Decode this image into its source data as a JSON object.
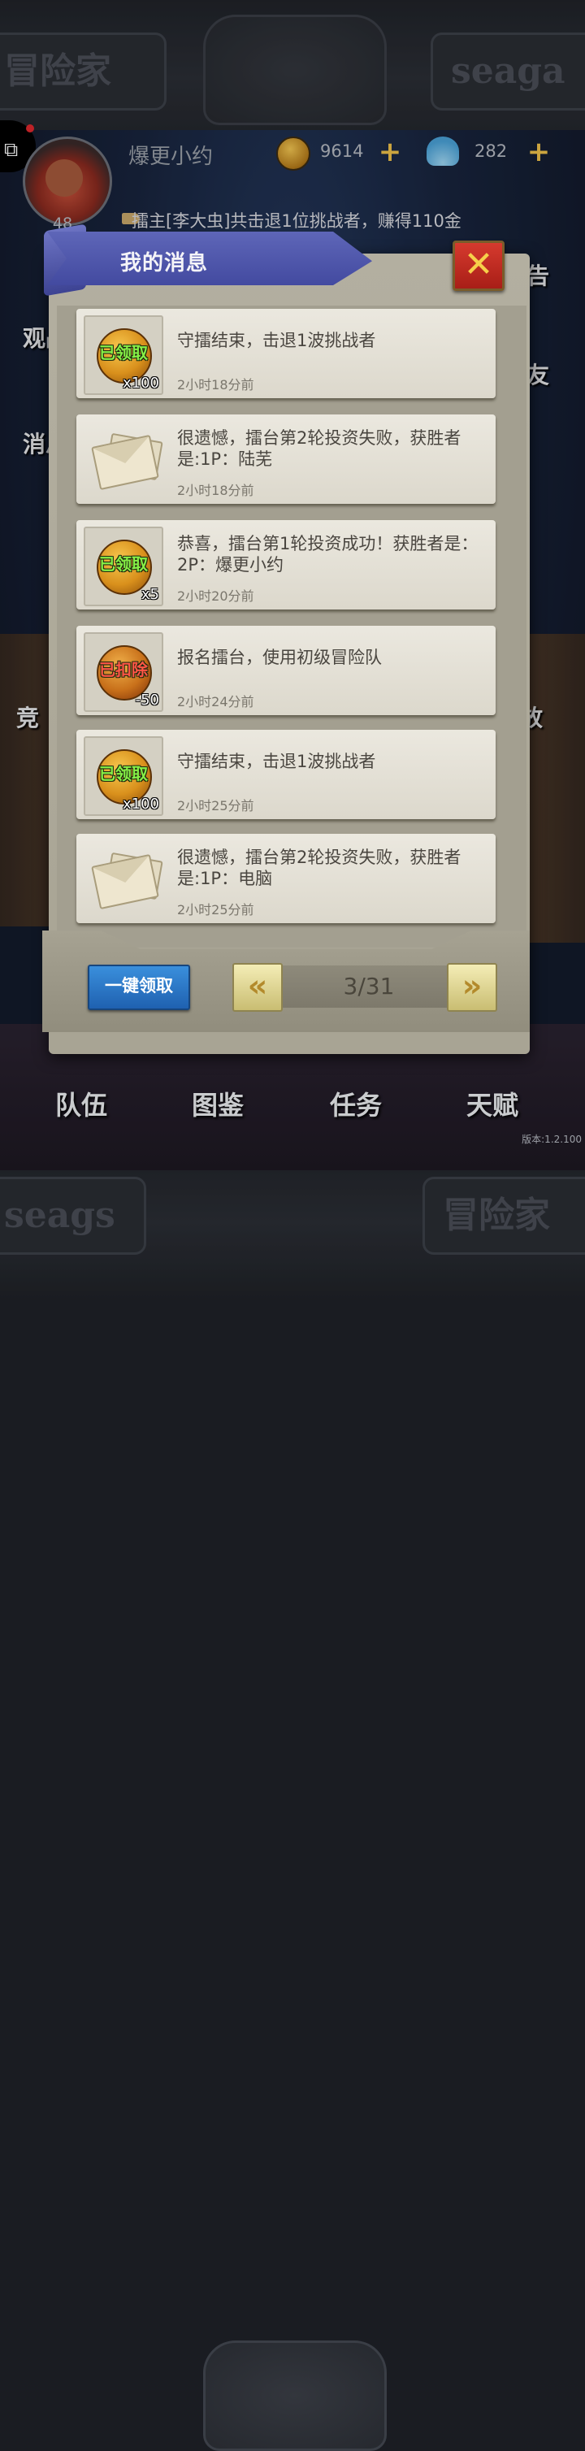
{
  "background": {
    "banner_left": "冒险家",
    "banner_right": "seaga",
    "banner_bottom_left": "seags",
    "banner_bottom_right": "冒险家"
  },
  "hud": {
    "level": "48",
    "player_name": "爆更小约",
    "coins": "9614",
    "shells": "282",
    "ticker": "擂主[李大虫]共击退1位挑战者，赚得110金"
  },
  "side_labels": {
    "guanzhan": "观战",
    "xiaoxi": "消息",
    "gonggao": "公告",
    "haoyou": "好友",
    "jing": "竞",
    "fang": "放"
  },
  "bottom_nav": [
    "队伍",
    "图鉴",
    "任务",
    "天赋"
  ],
  "version": "版本:1.2.100",
  "modal": {
    "title": "我的消息",
    "close": "✕",
    "messages": [
      {
        "icon": "coin-icon",
        "stamp": "已领取",
        "stamp_color": "#86ef46",
        "qty": "x100",
        "text": "守擂结束，击退1波挑战者",
        "time": "2小时18分前"
      },
      {
        "icon": "envelope-icon",
        "text": "很遗憾，擂台第2轮投资失败，获胜者是:1P：陆芜",
        "time": "2小时18分前"
      },
      {
        "icon": "coin-icon",
        "stamp": "已领取",
        "stamp_color": "#86ef46",
        "qty": "x5",
        "text": "恭喜，擂台第1轮投资成功！获胜者是：2P：爆更小约",
        "time": "2小时20分前"
      },
      {
        "icon": "coin-icon",
        "stamp": "已扣除",
        "stamp_color": "#ff5546",
        "qty": "-50",
        "text": "报名擂台，使用初级冒险队",
        "time": "2小时24分前"
      },
      {
        "icon": "coin-icon",
        "stamp": "已领取",
        "stamp_color": "#86ef46",
        "qty": "x100",
        "text": "守擂结束，击退1波挑战者",
        "time": "2小时25分前"
      },
      {
        "icon": "envelope-icon",
        "text": "很遗憾，擂台第2轮投资失败，获胜者是:1P：电脑",
        "time": "2小时25分前"
      }
    ],
    "claim_all": "一键领取",
    "page": "3/31"
  }
}
